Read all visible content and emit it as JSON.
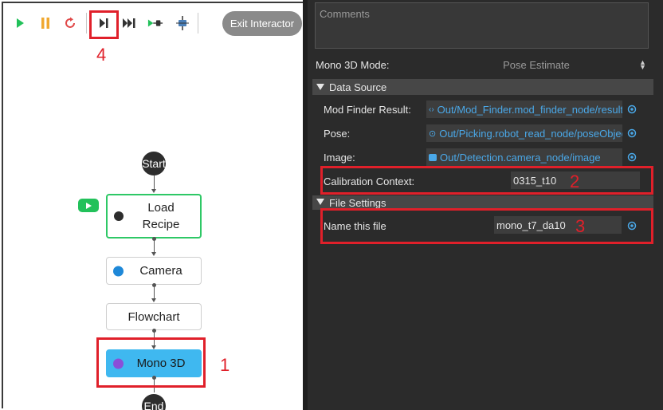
{
  "toolbar": {
    "exit_label": "Exit Interactor",
    "icons": [
      "play-icon",
      "pause-icon",
      "restart-icon",
      "step-icon",
      "skip-forward-icon",
      "run-to-node-icon",
      "breakpoint-icon"
    ]
  },
  "flow": {
    "start_label": "Start",
    "end_label": "End",
    "nodes": [
      {
        "label": "Load Recipe"
      },
      {
        "label": "Camera"
      },
      {
        "label": "Flowchart"
      },
      {
        "label": "Mono 3D"
      }
    ]
  },
  "annotations": {
    "n1": "1",
    "n2": "2",
    "n3": "3",
    "n4": "4"
  },
  "props": {
    "comments_placeholder": "Comments",
    "mode_label": "Mono 3D Mode:",
    "mode_value": "Pose Estimate",
    "data_source_title": "Data Source",
    "mod_finder_label": "Mod Finder Result:",
    "mod_finder_value": "Out/Mod_Finder.mod_finder_node/result",
    "pose_label": "Pose:",
    "pose_value": "Out/Picking.robot_read_node/poseObject",
    "image_label": "Image:",
    "image_value": "Out/Detection.camera_node/image",
    "calib_label": "Calibration Context:",
    "calib_value": "0315_t10",
    "file_settings_title": "File Settings",
    "name_file_label": "Name this file",
    "name_file_value": "mono_t7_da10"
  },
  "colors": {
    "accent": "#4aa8e8",
    "annotation": "#e0202a",
    "selected_node": "#3fb8f0",
    "active_node_border": "#2ec866"
  }
}
